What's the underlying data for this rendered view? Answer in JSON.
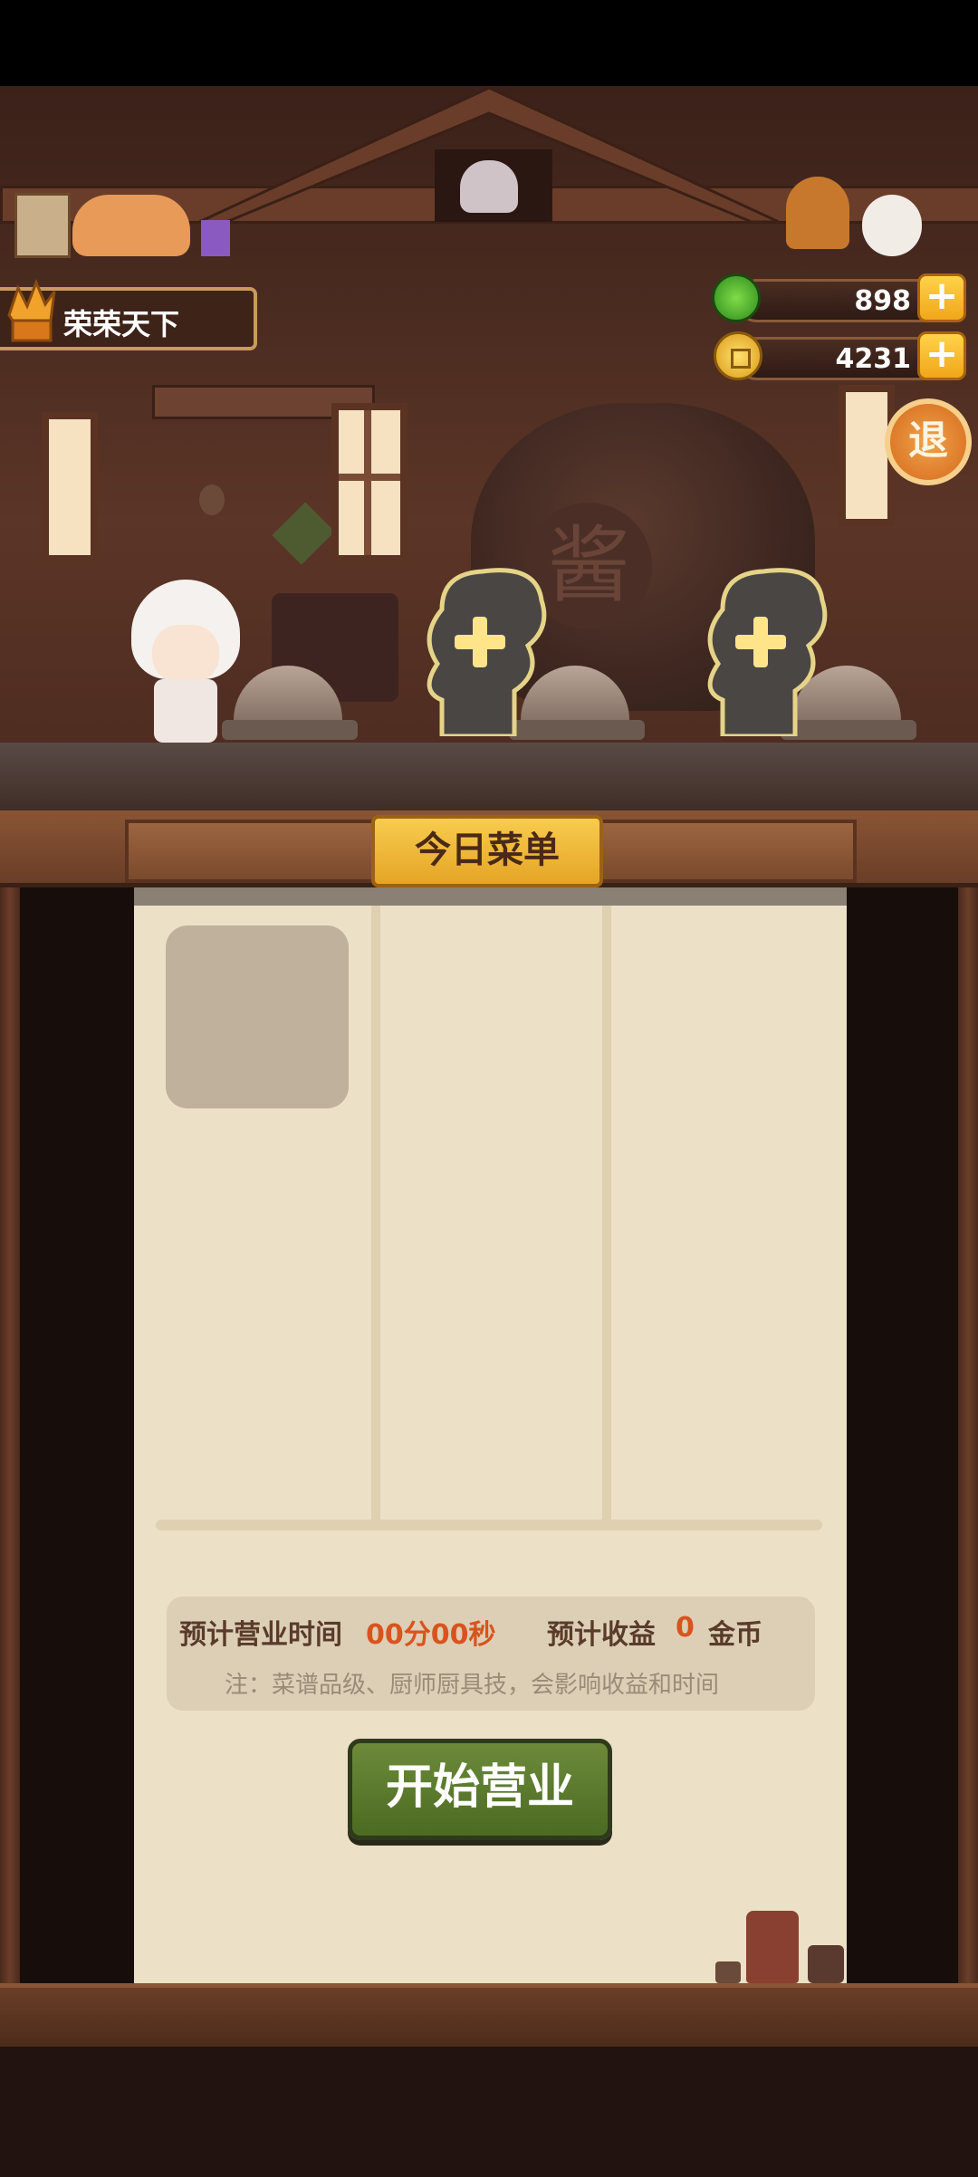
{
  "player": {
    "name": "荣荣天下"
  },
  "currency": {
    "jade": {
      "value": "898",
      "icon": "jade-icon"
    },
    "coins": {
      "value": "4231",
      "icon": "coin-icon"
    },
    "plus": "+"
  },
  "exit_button": "退",
  "chef_slots": [
    {
      "state": "occupied",
      "icon": "chef-character"
    },
    {
      "state": "empty",
      "plus": "+"
    },
    {
      "state": "empty",
      "plus": "+"
    }
  ],
  "jar_label": "酱",
  "menu": {
    "title": "今日菜单",
    "estimated_time_label": "预计营业时间",
    "estimated_time_value": "00分00秒",
    "estimated_income_label": "预计收益",
    "estimated_income_value": "0",
    "income_unit": "金币",
    "note": "注：菜谱品级、厨师厨具技，会影响收益和时间",
    "start_button": "开始营业"
  }
}
